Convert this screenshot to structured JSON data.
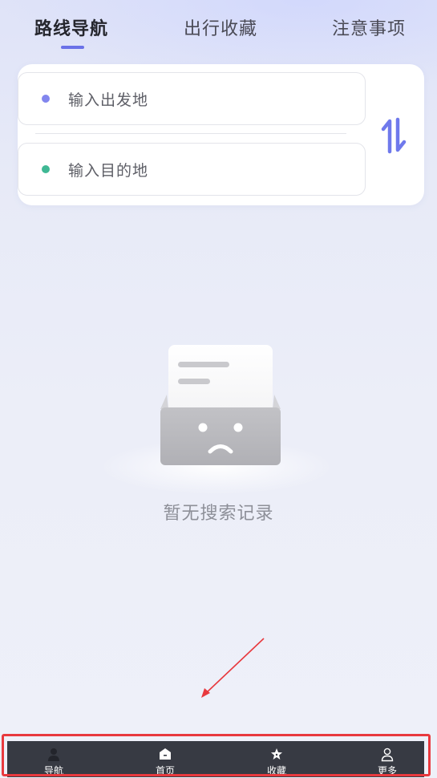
{
  "tabs": [
    {
      "label": "路线导航",
      "active": true
    },
    {
      "label": "出行收藏",
      "active": false
    },
    {
      "label": "注意事项",
      "active": false
    }
  ],
  "route": {
    "origin_placeholder": "输入出发地",
    "destination_placeholder": "输入目的地",
    "origin_dot_color": "#8286ee",
    "destination_dot_color": "#3fb894",
    "swap_icon": "swap-vertical-arrows-icon",
    "swap_color": "#6f79ec"
  },
  "empty_state": {
    "message": "暂无搜索记录",
    "illustration": "empty-box-sad-face-icon"
  },
  "bottom_nav": [
    {
      "label": "导航",
      "icon": "person-icon"
    },
    {
      "label": "首页",
      "icon": "home-icon"
    },
    {
      "label": "收藏",
      "icon": "star-icon"
    },
    {
      "label": "更多",
      "icon": "user-outline-icon"
    }
  ],
  "annotation": {
    "arrow_color": "#e8393e",
    "highlight_color": "#e8393e"
  }
}
